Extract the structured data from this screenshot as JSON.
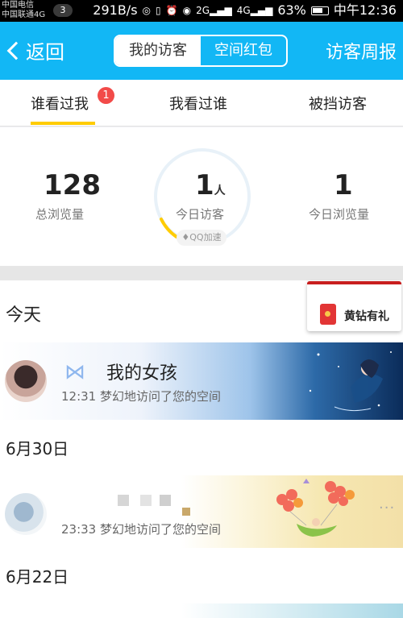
{
  "status_bar": {
    "carrier1": "中国电信",
    "carrier2": "中国联通4G",
    "notif_count": "3",
    "speed": "291B/s",
    "network_a": "2G",
    "network_b": "4G",
    "battery": "63%",
    "time": "中午12:36"
  },
  "nav": {
    "back_label": "返回",
    "segments": [
      "我的访客",
      "空间红包"
    ],
    "right_label": "访客周报"
  },
  "tabs": {
    "items": [
      "谁看过我",
      "我看过谁",
      "被挡访客"
    ],
    "badge": "1",
    "active_index": 0
  },
  "stats": {
    "total_views": "128",
    "total_views_label": "总浏览量",
    "today_visitors": "1",
    "today_visitors_unit": "人",
    "today_visitors_label": "今日访客",
    "today_views": "1",
    "today_views_label": "今日浏览量",
    "qq_chip": "QQ加速"
  },
  "feed": {
    "today_label": "今天",
    "redpacket": "黄钻有礼",
    "groups": [
      {
        "visitors": [
          {
            "name": "我的女孩",
            "time": "12:31",
            "action": "梦幻地访问了您的空间"
          }
        ]
      },
      {
        "date": "6月30日",
        "visitors": [
          {
            "name": "",
            "time": "23:33",
            "action": "梦幻地访问了您的空间"
          }
        ]
      },
      {
        "date": "6月22日"
      }
    ]
  },
  "colors": {
    "nav_blue": "#12b7f5",
    "tab_underline": "#ffcc00",
    "badge_red": "#f24b49",
    "ring_progress": "#ffcc00"
  }
}
